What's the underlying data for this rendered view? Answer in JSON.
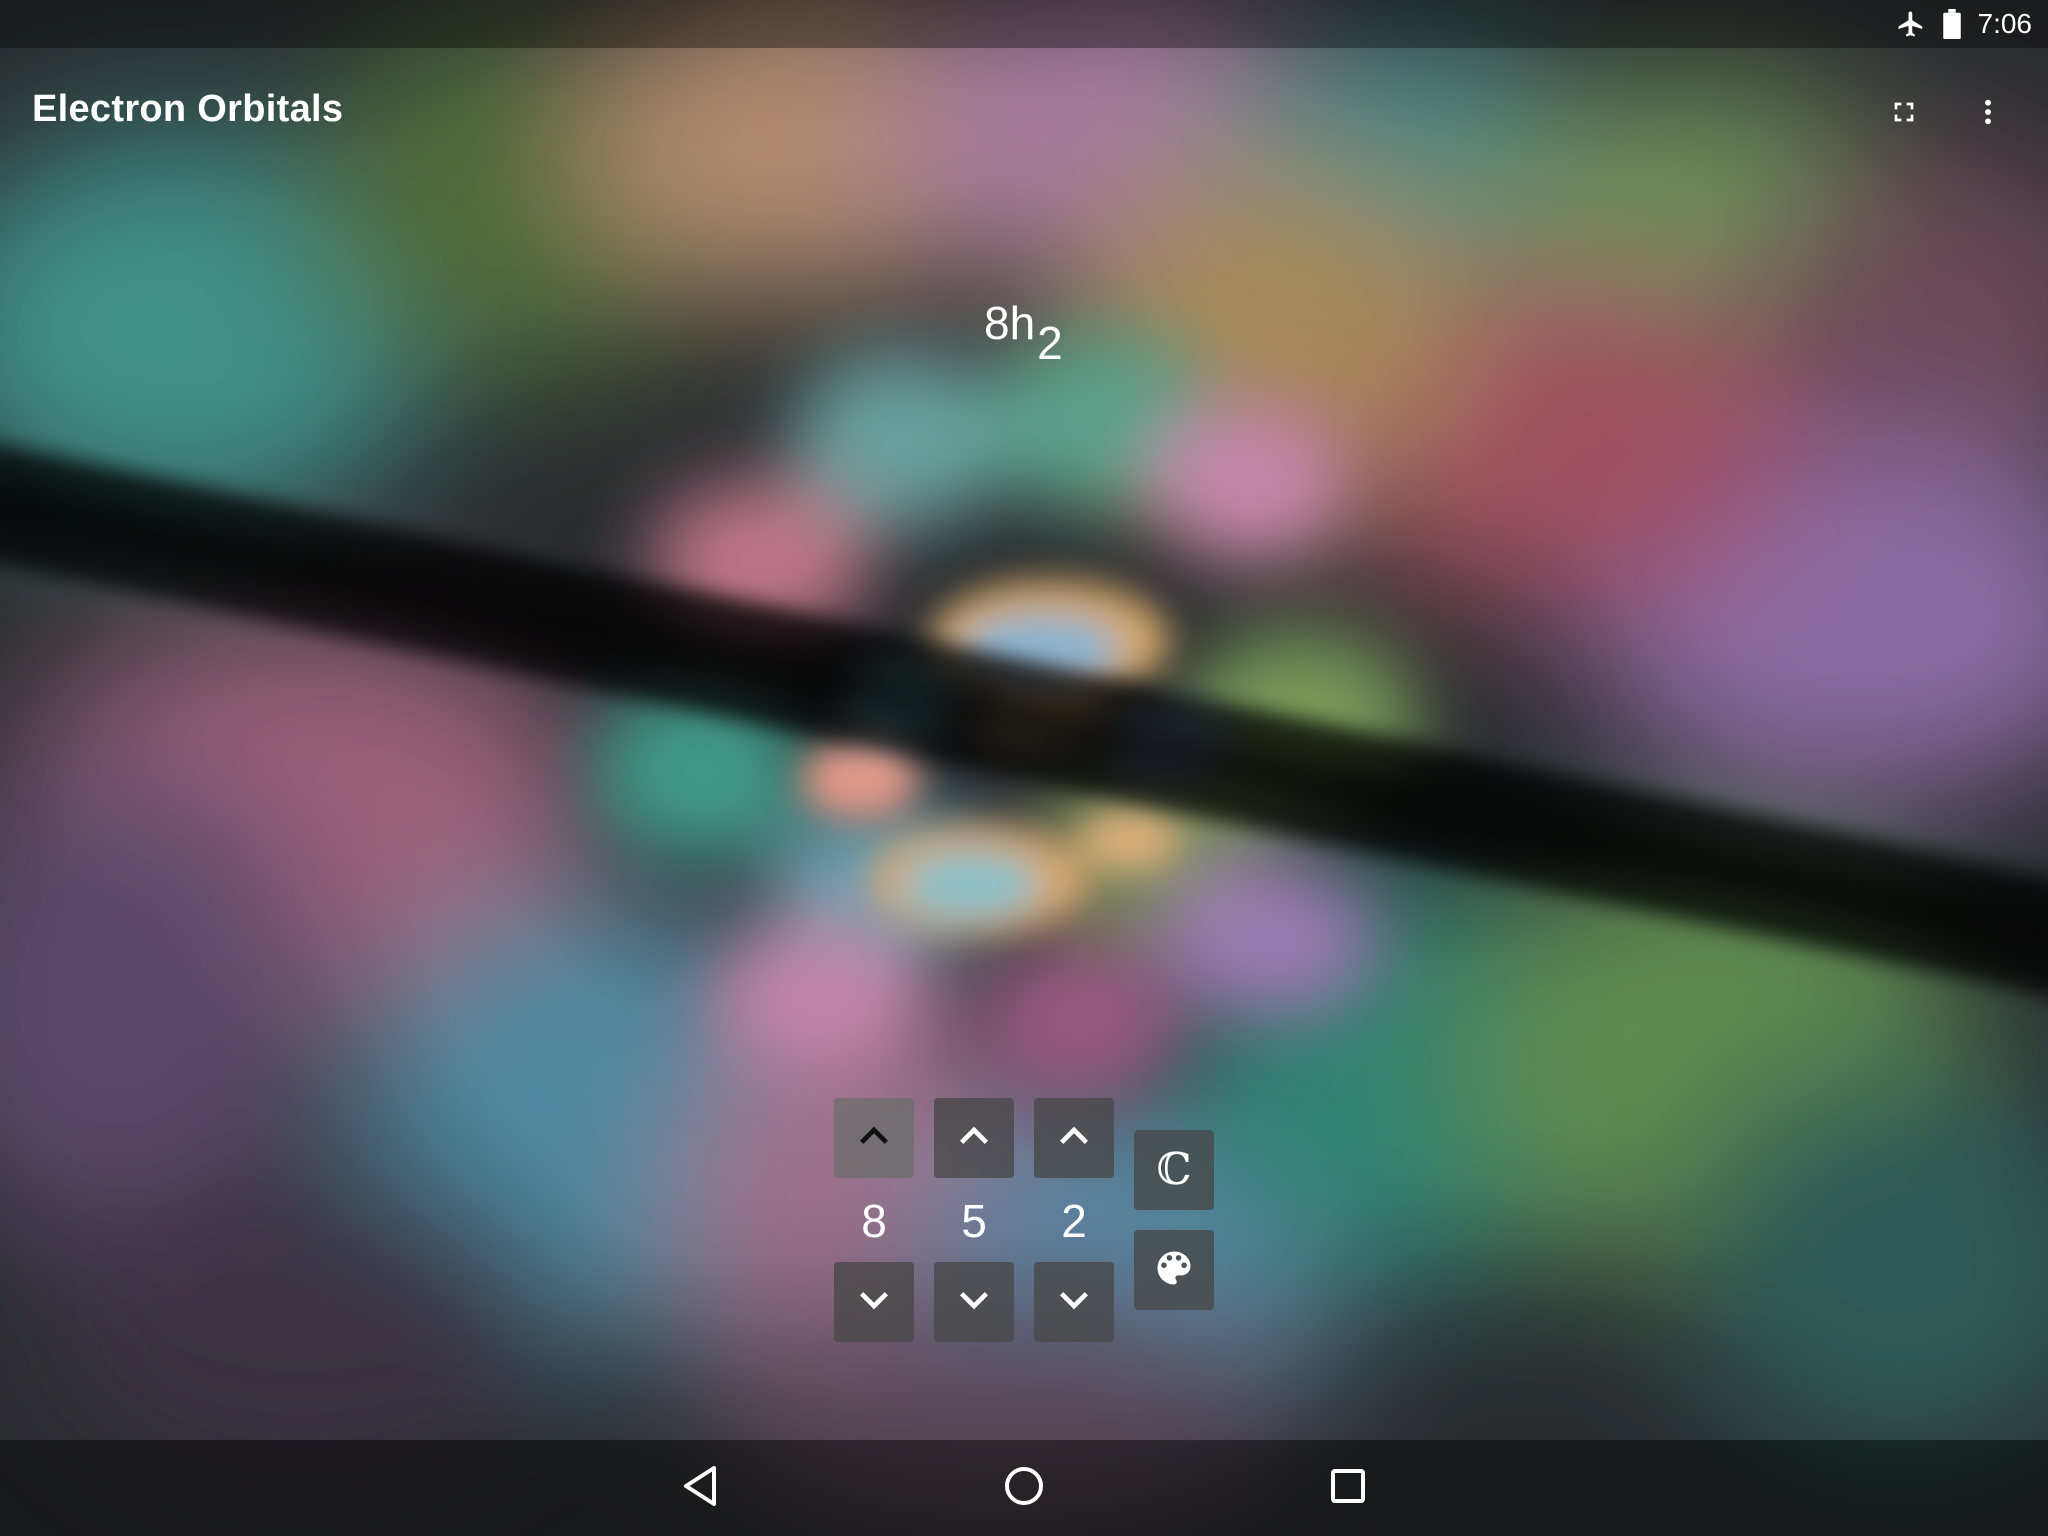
{
  "status_bar": {
    "time": "7:06",
    "icons": [
      "airplane-mode-icon",
      "battery-full-icon"
    ]
  },
  "app_bar": {
    "title": "Electron Orbitals",
    "actions": [
      "fullscreen-icon",
      "more-vert-icon"
    ]
  },
  "orbital": {
    "main": "8h",
    "subscript": "2"
  },
  "quantum_numbers": {
    "n": "8",
    "l": "5",
    "m": "2"
  },
  "side_buttons": {
    "complex_symbol": "ℂ",
    "palette": "palette-icon"
  },
  "nav_bar": {
    "buttons": [
      "back-icon",
      "home-icon",
      "recents-icon"
    ]
  },
  "colors": {
    "text": "#ffffff",
    "button_bg": "#484848",
    "background_dark": "#000000"
  }
}
